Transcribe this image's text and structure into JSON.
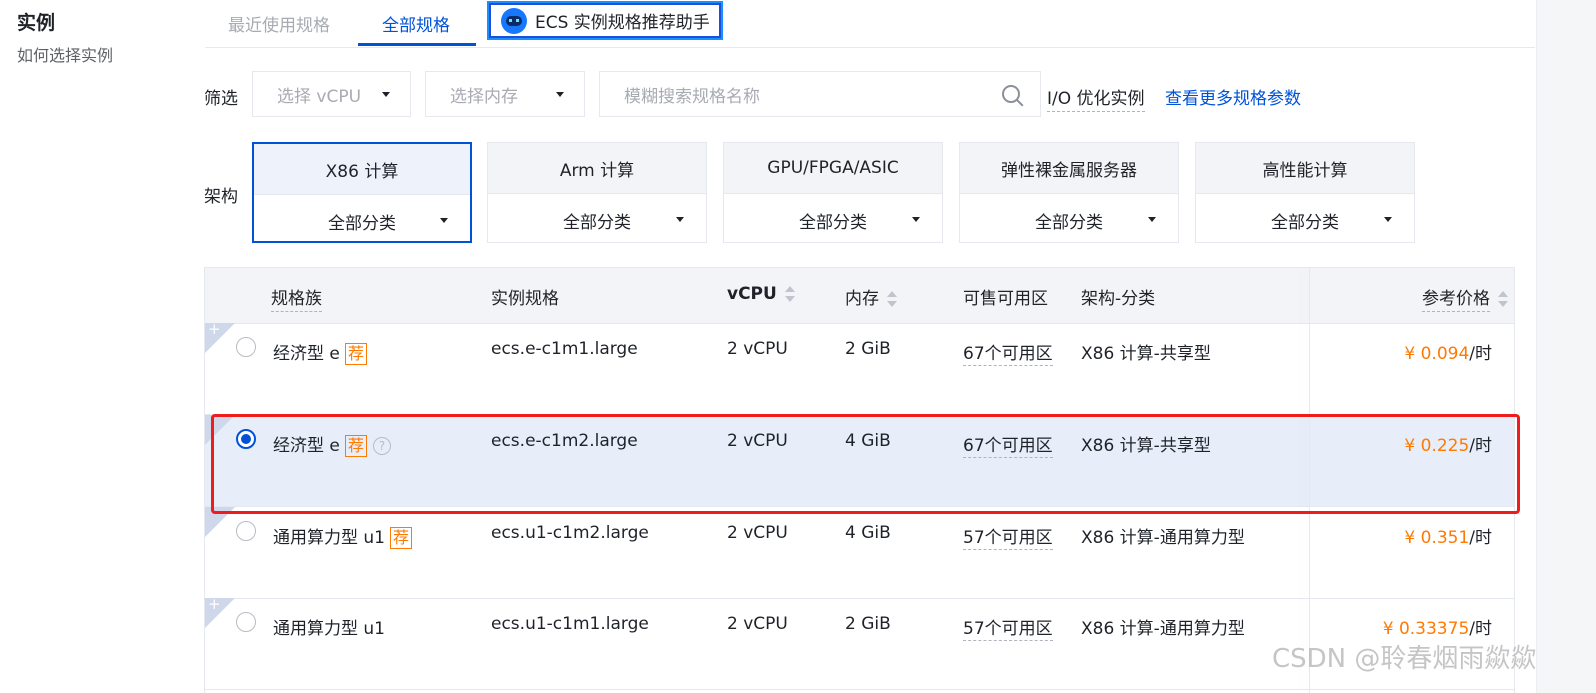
{
  "sidebar": {
    "title": "实例",
    "help_link": "如何选择实例"
  },
  "tabs": {
    "recent": "最近使用规格",
    "all": "全部规格",
    "assistant": "ECS 实例规格推荐助手"
  },
  "filters": {
    "label": "筛选",
    "vcpu_placeholder": "选择 vCPU",
    "memory_placeholder": "选择内存",
    "search_placeholder": "模糊搜索规格名称",
    "io_optimized": "I/O 优化实例",
    "more_params": "查看更多规格参数"
  },
  "architecture": {
    "label": "架构",
    "cards": [
      {
        "title": "X86 计算",
        "category": "全部分类",
        "selected": true
      },
      {
        "title": "Arm 计算",
        "category": "全部分类",
        "selected": false
      },
      {
        "title": "GPU/FPGA/ASIC",
        "category": "全部分类",
        "selected": false
      },
      {
        "title": "弹性裸金属服务器",
        "category": "全部分类",
        "selected": false
      },
      {
        "title": "高性能计算",
        "category": "全部分类",
        "selected": false
      }
    ]
  },
  "table": {
    "headers": {
      "family": "规格族",
      "spec": "实例规格",
      "vcpu": "vCPU",
      "memory": "内存",
      "zones": "可售可用区",
      "arch": "架构-分类",
      "price": "参考价格"
    },
    "rows": [
      {
        "family": "经济型 e",
        "badge": "荐",
        "help": "",
        "spec": "ecs.e-c1m1.large",
        "vcpu": "2 vCPU",
        "memory": "2 GiB",
        "zones": "67个可用区",
        "arch": "X86 计算-共享型",
        "price": "¥ 0.094",
        "unit": "/时",
        "selected": false
      },
      {
        "family": "经济型 e",
        "badge": "荐",
        "help": "?",
        "spec": "ecs.e-c1m2.large",
        "vcpu": "2 vCPU",
        "memory": "4 GiB",
        "zones": "67个可用区",
        "arch": "X86 计算-共享型",
        "price": "¥ 0.225",
        "unit": "/时",
        "selected": true
      },
      {
        "family": "通用算力型 u1",
        "badge": "荐",
        "help": "",
        "spec": "ecs.u1-c1m2.large",
        "vcpu": "2 vCPU",
        "memory": "4 GiB",
        "zones": "57个可用区",
        "arch": "X86 计算-通用算力型",
        "price": "¥ 0.351",
        "unit": "/时",
        "selected": false
      },
      {
        "family": "通用算力型 u1",
        "badge": "",
        "help": "",
        "spec": "ecs.u1-c1m1.large",
        "vcpu": "2 vCPU",
        "memory": "2 GiB",
        "zones": "57个可用区",
        "arch": "X86 计算-通用算力型",
        "price": "¥ 0.33375",
        "unit": "/时",
        "selected": false
      }
    ]
  },
  "corner_plus": "+",
  "watermark": "CSDN @聆春烟雨歘歘",
  "colors": {
    "accent": "#0052d9",
    "price": "#ff7a00",
    "highlight": "#ee1c1c"
  }
}
